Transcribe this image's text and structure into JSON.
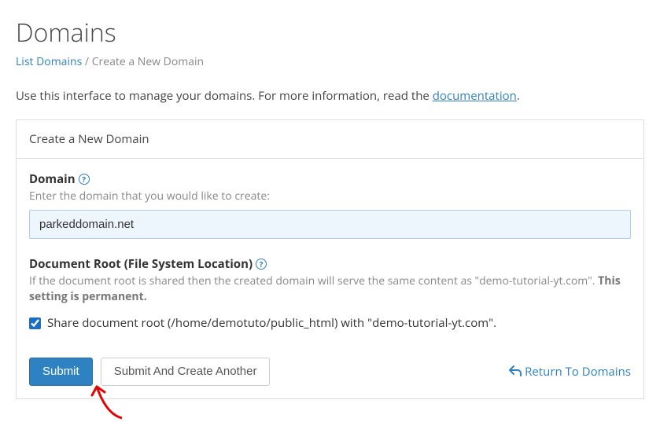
{
  "page": {
    "title": "Domains",
    "intro_prefix": "Use this interface to manage your domains. For more information, read the ",
    "intro_link": "documentation",
    "intro_suffix": "."
  },
  "breadcrumb": {
    "link": "List Domains",
    "separator": " / ",
    "current": "Create a New Domain"
  },
  "panel": {
    "header": "Create a New Domain"
  },
  "domain_field": {
    "label": "Domain",
    "hint": "Enter the domain that you would like to create:",
    "value": "parkeddomain.net"
  },
  "docroot_field": {
    "label": "Document Root (File System Location)",
    "desc_prefix": "If the document root is shared then the created domain will serve the same content as \"demo-tutorial-yt.com\". ",
    "desc_strong": "This setting is permanent."
  },
  "share_checkbox": {
    "label": "Share document root (/home/demotuto/public_html) with \"demo-tutorial-yt.com\"."
  },
  "buttons": {
    "submit": "Submit",
    "submit_another": "Submit And Create Another",
    "return": "Return To Domains"
  }
}
